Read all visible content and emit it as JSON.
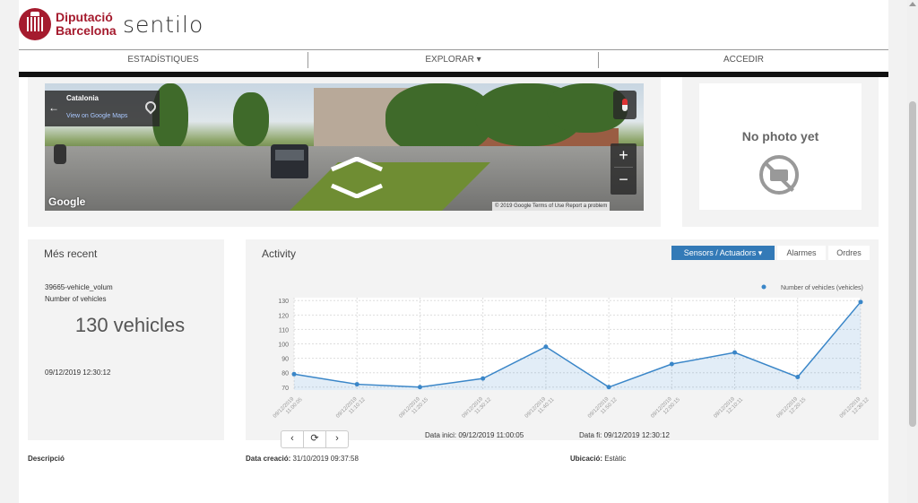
{
  "brand": {
    "org_line1": "Diputació",
    "org_line2": "Barcelona",
    "app": "sentilo"
  },
  "nav": {
    "stats": "ESTADÍSTIQUES",
    "explore": "EXPLORAR",
    "explore_caret": "▾",
    "access": "ACCEDIR"
  },
  "streetview": {
    "location": "Catalonia",
    "link": "View on Google Maps",
    "back": "←",
    "google": "Google",
    "legal": "© 2019 Google  Terms of Use  Report a problem",
    "zoom_in": "+",
    "zoom_out": "−"
  },
  "photo": {
    "placeholder": "No photo yet"
  },
  "recent": {
    "title": "Més recent",
    "sensor": "39665-vehicle_volum",
    "type": "Number of vehicles",
    "value": "130 vehicles",
    "timestamp": "09/12/2019 12:30:12"
  },
  "activity": {
    "title": "Activity",
    "tabs": {
      "sensors": "Sensors / Actuadors ▾",
      "alarms": "Alarmes",
      "orders": "Ordres"
    },
    "pager": {
      "prev": "‹",
      "refresh": "⟳",
      "next": "›"
    },
    "start": "Data inici: 09/12/2019 11:00:05",
    "end": "Data fi: 09/12/2019 12:30:12"
  },
  "chart_data": {
    "type": "area",
    "series": [
      {
        "name": "Number of vehicles (vehicles)",
        "values": [
          79,
          72,
          70,
          76,
          98,
          70,
          86,
          94,
          77,
          129
        ]
      }
    ],
    "x": [
      "09/12/2019 11:00:05",
      "09/12/2019 11:10:12",
      "09/12/2019 11:20:15",
      "09/12/2019 11:30:12",
      "09/12/2019 11:40:11",
      "09/12/2019 11:50:12",
      "09/12/2019 12:00:15",
      "09/12/2019 12:10:11",
      "09/12/2019 12:20:15",
      "09/12/2019 12:30:12"
    ],
    "yticks": [
      70,
      80,
      90,
      100,
      110,
      120,
      130
    ],
    "ylim": [
      68,
      132
    ],
    "legend": "top-right",
    "grid": true,
    "color": "#3a86c8"
  },
  "meta": {
    "desc_label": "Descripció",
    "created_label": "Data creació:",
    "created_value": "31/10/2019 09:37:58",
    "location_label": "Ubicació:",
    "location_value": "Estàtic"
  }
}
